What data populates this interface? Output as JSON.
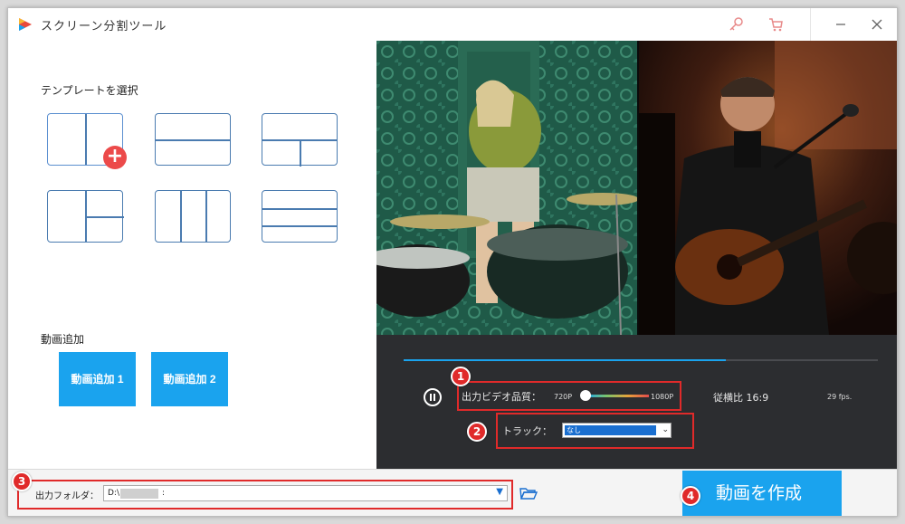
{
  "app": {
    "title": "スクリーン分割ツール",
    "accent_color": "#1aa3ee",
    "icons": [
      "app-logo-icon",
      "key-icon",
      "cart-icon",
      "minimize-icon",
      "close-icon"
    ]
  },
  "templates": {
    "title": "テンプレートを選択",
    "items": [
      "two-columns",
      "two-rows",
      "top-bottom-split-right",
      "left-right-split-bottom",
      "three-columns",
      "three-rows"
    ],
    "selected_index": 0
  },
  "add_video": {
    "title": "動画追加",
    "buttons": [
      "動画追加 1",
      "動画追加 2"
    ]
  },
  "player": {
    "progress": 0.68,
    "quality_label": "出力ビデオ品質：",
    "quality_min": "720P",
    "quality_max": "1080P",
    "quality_level": 0.0,
    "aspect": "従横比 16:9",
    "fps": "29 fps.",
    "track_label": "トラック：",
    "track_value": "なし"
  },
  "output": {
    "label": "出力フォルダ：",
    "path": "D:\\",
    "path_suffix": ":"
  },
  "create_button": "動画を作成",
  "annotations": [
    "1",
    "2",
    "3",
    "4"
  ]
}
